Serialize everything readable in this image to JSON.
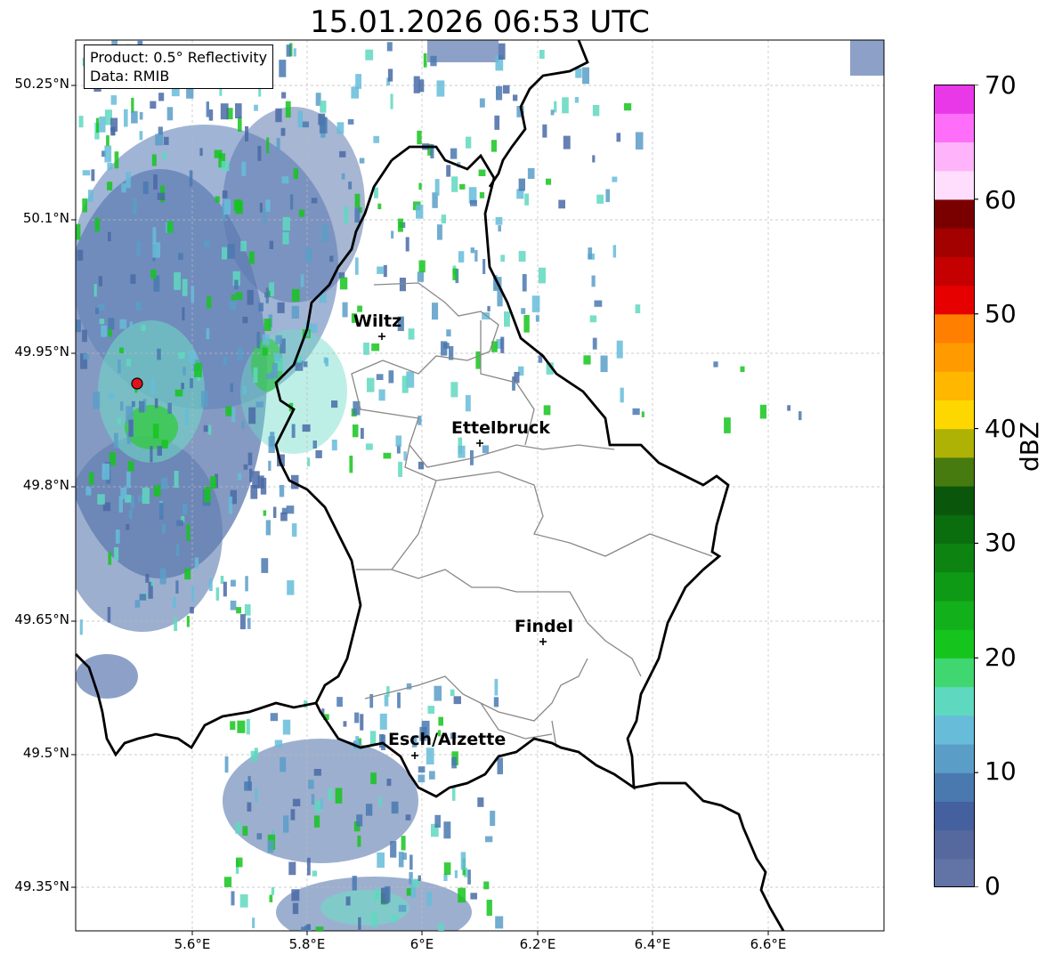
{
  "title": "15.01.2026 06:53 UTC",
  "info": {
    "product": "Product: 0.5° Reflectivity",
    "data": "Data: RMIB"
  },
  "lat_labels": [
    "50.25°N",
    "50.1°N",
    "49.95°N",
    "49.8°N",
    "49.65°N",
    "49.5°N",
    "49.35°N"
  ],
  "lon_labels": [
    "5.6°E",
    "5.8°E",
    "6°E",
    "6.2°E",
    "6.4°E",
    "6.6°E"
  ],
  "cities": [
    {
      "name": "Wiltz"
    },
    {
      "name": "Ettelbruck"
    },
    {
      "name": "Findel"
    },
    {
      "name": "Esch/Alzette"
    }
  ],
  "colorbar": {
    "label": "dBZ",
    "ticks": [
      "70",
      "60",
      "50",
      "40",
      "30",
      "20",
      "10",
      "0"
    ],
    "colors": [
      "#6273a6",
      "#55699e",
      "#45609f",
      "#4a79b0",
      "#5a9ec8",
      "#66bcd9",
      "#5fd8c0",
      "#40d670",
      "#16c41e",
      "#12b01a",
      "#0f9a16",
      "#0d8412",
      "#0a6d0e",
      "#0a560b",
      "#477a0f",
      "#adb204",
      "#ffd700",
      "#ffb700",
      "#ff9b00",
      "#ff7f00",
      "#e60000",
      "#c40000",
      "#a30000",
      "#7a0000",
      "#ffddfd",
      "#ffb3fb",
      "#ff6ef8",
      "#e838e8"
    ]
  },
  "colors": {
    "border": "#000000",
    "canton": "#888888",
    "radar_site": "#e0141a",
    "grid": "#bbbbbb"
  },
  "radar_site_icon": "radar-site-marker"
}
